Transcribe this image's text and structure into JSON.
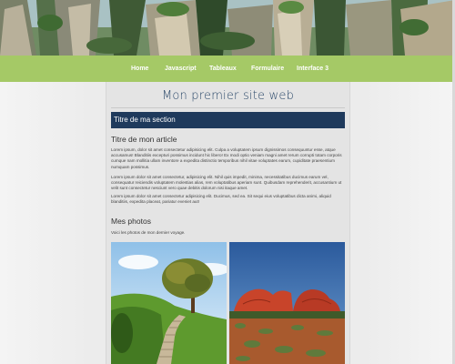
{
  "header": {
    "banner_image": "mountain-pillars-landscape"
  },
  "nav": {
    "items": [
      {
        "label": "Home"
      },
      {
        "label": "Javascript"
      },
      {
        "label": "Tableaux"
      },
      {
        "label": "Formulaire"
      },
      {
        "label": "Interface 3"
      }
    ]
  },
  "main": {
    "site_title": "Mon premier site web",
    "section_title": "Titre de ma section",
    "article": {
      "title": "Titre de mon article",
      "paragraphs": [
        "Lorem ipsum, dolor sit amet consectetur adipisicing elit. Culpa a voluptatem ipsum dignissimos consequuntur esse, atque accusamus! Blanditiis excepturi possimus incidunt hic libero! Ex modi optio veniam magni amet rerum corrupti totam corporis cumque nam mollitia ullam inventore a expedita distinctio temporibus nihil vitae voluptates earum, cupiditate praesentium numquam possimus.",
        "Lorem ipsum dolor sit amet consectetur, adipisicing elit. Nihil quis impedit, minima, necessitatibus ducimus earum vel, consequatur reiciendis voluptatem molestias alias, rem voluptatibus aperiam sunt. Quibusdam reprehenderit, accusantium ut velit sunt consectetur nesciunt vero quae debitis dolorum nisi itaque amet.",
        "Lorem ipsum dolor sit amet consectetur adipisicing elit. Ducimus, sed ea. Sit sequi eius voluptatibus dicta animi, aliquid blanditiis, expedita placeat, pariatur eveniet aut!"
      ]
    },
    "photos": {
      "title": "Mes photos",
      "caption": "Voici les photos de mon dernier voyage.",
      "images": [
        {
          "subject": "hillside-stone-stairs-tree"
        },
        {
          "subject": "red-rock-domes-desert"
        }
      ]
    }
  },
  "colors": {
    "nav_bg": "#a5c966",
    "section_bar": "#1f3a5c",
    "site_title": "#2d4a6b"
  }
}
